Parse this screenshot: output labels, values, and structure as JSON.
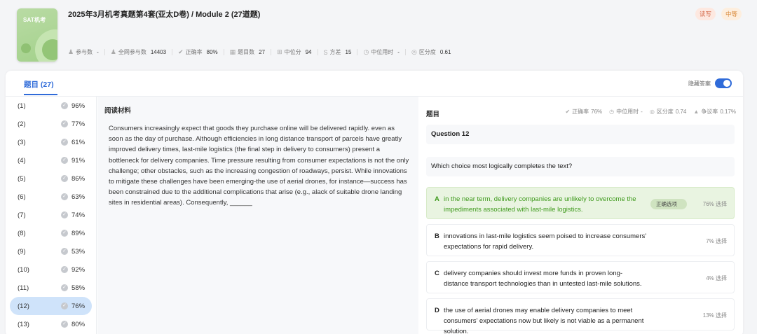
{
  "header": {
    "cover_text": "SAT机考",
    "title": "2025年3月机考真题第4套(亚太D卷) / Module 2 (27道题)",
    "tags": [
      "读写",
      "中等"
    ],
    "stats": [
      {
        "icon": "user-icon",
        "label": "参与数",
        "value": "-"
      },
      {
        "icon": "users-icon",
        "label": "全网参与数",
        "value": "14403"
      },
      {
        "icon": "check-circle-icon",
        "label": "正确率",
        "value": "80%"
      },
      {
        "icon": "list-icon",
        "label": "题目数",
        "value": "27"
      },
      {
        "icon": "median-icon",
        "label": "中位分",
        "value": "94"
      },
      {
        "icon": "variance-icon",
        "label": "方差",
        "value": "15"
      },
      {
        "icon": "clock-icon",
        "label": "中位用时",
        "value": "-"
      },
      {
        "icon": "target-icon",
        "label": "区分度",
        "value": "0.61"
      }
    ]
  },
  "tabs": {
    "questions_label": "题目 (27)",
    "hide_answer_label": "隐藏答案",
    "hide_answer_on": true
  },
  "question_list": [
    {
      "num": "(1)",
      "pct": "96%"
    },
    {
      "num": "(2)",
      "pct": "77%"
    },
    {
      "num": "(3)",
      "pct": "61%"
    },
    {
      "num": "(4)",
      "pct": "91%"
    },
    {
      "num": "(5)",
      "pct": "86%"
    },
    {
      "num": "(6)",
      "pct": "63%"
    },
    {
      "num": "(7)",
      "pct": "74%"
    },
    {
      "num": "(8)",
      "pct": "89%"
    },
    {
      "num": "(9)",
      "pct": "53%"
    },
    {
      "num": "(10)",
      "pct": "92%"
    },
    {
      "num": "(11)",
      "pct": "58%"
    },
    {
      "num": "(12)",
      "pct": "76%",
      "active": true
    },
    {
      "num": "(13)",
      "pct": "80%"
    }
  ],
  "passage": {
    "heading": "阅读材料",
    "text": "Consumers increasingly expect that goods they purchase online will be delivered rapidly. even as soon as the day of purchase. Although efficiencies in long distance transport of parcels have greatly improved delivery times, last-mile logistics (the final step in delivery to consumers) present a bottleneck for delivery companies. Time pressure resulting from consumer expectations is not the only challenge; other obstacles, such as the increasing congestion of roadways, persist. While innovations to mitigate these challenges have been emerging-the use of aerial drones, for instance—success has been constrained due to the additional complications that arise (e.g., alack of suitable drone landing sites in residential areas). Consequently, ______"
  },
  "question": {
    "heading": "题目",
    "stats": [
      {
        "icon": "check-circle-icon",
        "label": "正确率",
        "value": "76%"
      },
      {
        "icon": "clock-icon",
        "label": "中位用时",
        "value": "-"
      },
      {
        "icon": "target-icon",
        "label": "区分度",
        "value": "0.74"
      },
      {
        "icon": "warning-icon",
        "label": "争议率",
        "value": "0.17%"
      }
    ],
    "number": "Question 12",
    "prompt": "Which choice most logically completes the text?",
    "correct_badge": "正确选项",
    "choices": [
      {
        "letter": "A",
        "text": "in the near term, delivery companies are unlikely to overcome the impediments associated with last-mile logistics.",
        "select": "76% 选择",
        "correct": true
      },
      {
        "letter": "B",
        "text": "innovations in last-mile logistics seem poised to increase consumers' expectations for rapid delivery.",
        "select": "7% 选择"
      },
      {
        "letter": "C",
        "text": "delivery companies should invest more funds in proven long-distance transport technologies than in untested last-mile solutions.",
        "select": "4% 选择"
      },
      {
        "letter": "D",
        "text": "the use of aerial drones may enable delivery companies to meet consumers' expectations now but likely is not viable as a permanent solution.",
        "select": "13% 选择"
      }
    ]
  },
  "colors": {
    "accent": "#2f6bd9",
    "correct_bg": "#e9f4e1",
    "correct_text": "#3e9a1c",
    "active_row": "#cfe3fa"
  }
}
